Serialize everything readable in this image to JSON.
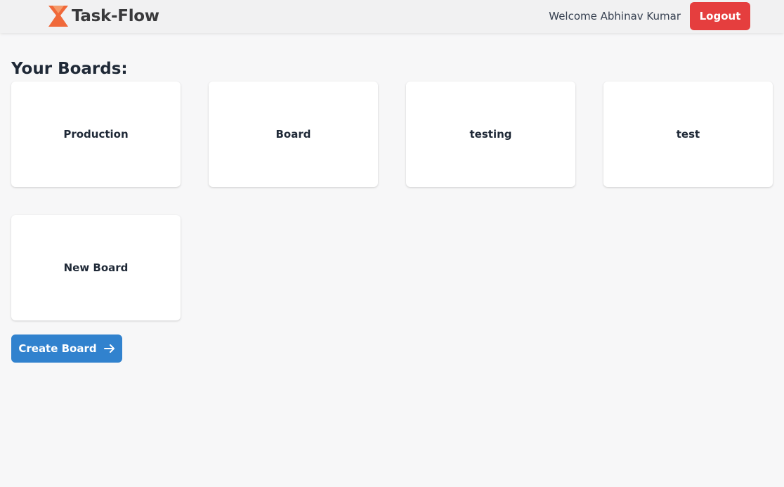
{
  "navbar": {
    "logo_text": "Task-Flow",
    "welcome_text": "Welcome Abhinav Kumar",
    "logout_label": "Logout"
  },
  "main": {
    "heading": "Your Boards:",
    "boards": [
      {
        "name": "Production"
      },
      {
        "name": "Board"
      },
      {
        "name": "testing"
      },
      {
        "name": "test"
      },
      {
        "name": "New Board"
      }
    ],
    "create_label": "Create Board",
    "create_icon": "arrow-right-icon"
  },
  "colors": {
    "logo_orange": "#f0693a",
    "logout_red": "#e53e3e",
    "primary_blue": "#3182ce",
    "navbar_bg": "#f1f1f2",
    "page_bg": "#f7f7f8"
  }
}
